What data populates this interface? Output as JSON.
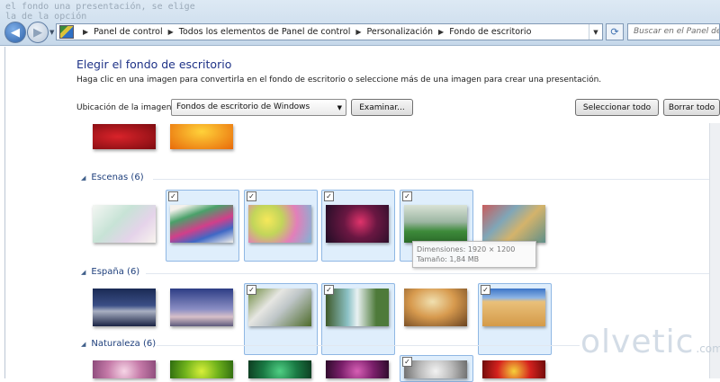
{
  "background_text": [
    "el fondo una presentación, se elige",
    "la de la opción"
  ],
  "nav": {
    "back_icon": "back-arrow-icon",
    "forward_icon": "forward-arrow-icon"
  },
  "address_bar": {
    "crumbs": [
      "Panel de control",
      "Todos los elementos de Panel de control",
      "Personalización",
      "Fondo de escritorio"
    ]
  },
  "search": {
    "placeholder": "Buscar en el Panel de control"
  },
  "page": {
    "title": "Elegir el fondo de escritorio",
    "description": "Haga clic en una imagen para convertirla en el fondo de escritorio o seleccione más de una imagen para crear una presentación."
  },
  "location": {
    "label": "Ubicación de la imagen:",
    "value": "Fondos de escritorio de Windows"
  },
  "buttons": {
    "browse": "Examinar...",
    "select_all": "Seleccionar todo",
    "clear_all": "Borrar todo"
  },
  "groups": [
    {
      "name": "Escenas (6)"
    },
    {
      "name": "España (6)"
    },
    {
      "name": "Naturaleza (6)"
    }
  ],
  "tooltip": {
    "line1": "Dimensiones: 1920 × 1200",
    "line2": "Tamaño: 1,84 MB"
  },
  "watermark": {
    "brand": "olvetic",
    "domain": ".com"
  },
  "colors": {
    "title": "#1e3287",
    "group": "#1e3f7c",
    "selection": "#dfeefc"
  }
}
